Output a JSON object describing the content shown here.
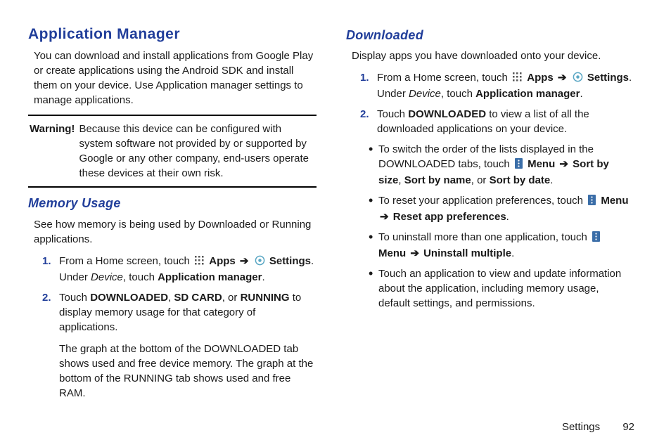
{
  "left": {
    "h1": "Application Manager",
    "intro": "You can download and install applications from Google Play or create applications using the Android SDK and install them on your device. Use Application manager settings to manage applications.",
    "warn_label": "Warning!",
    "warn_text": "Because this device can be configured with system software not provided by or supported by Google or any other company, end-users operate these devices at their own risk.",
    "h2": "Memory Usage",
    "memory_intro": "See how memory is being used by Downloaded or Running applications.",
    "step1_a": "From a Home screen, touch ",
    "apps": "Apps",
    "settings": "Settings",
    "step1_b": ". Under ",
    "device": "Device",
    "step1_c": ", touch ",
    "app_mgr": "Application manager",
    "period": ".",
    "step2_a": "Touch ",
    "downloaded": "DOWNLOADED",
    "sdcard": "SD CARD",
    "running": "RUNNING",
    "step2_b": " to display memory usage for that category of applications.",
    "comma_or": ", or ",
    "comma": ", ",
    "graph": "The graph at the bottom of the DOWNLOADED tab shows used and free device memory. The graph at the bottom of the RUNNING tab shows used and free RAM."
  },
  "right": {
    "h2": "Downloaded",
    "intro": "Display apps you have downloaded onto your device.",
    "step1_a": "From a Home screen, touch ",
    "apps": "Apps",
    "settings": "Settings",
    "step1_b": ". Under ",
    "device": "Device",
    "step1_c": ", touch ",
    "app_mgr": "Application manager",
    "period": ".",
    "step2_a": "Touch ",
    "downloaded": "DOWNLOADED",
    "step2_b": " to view a list of all the downloaded applications on your device.",
    "b1_a": "To switch the order of the lists displayed in the DOWNLOADED tabs, touch ",
    "menu": "Menu",
    "sort_size": "Sort by size",
    "sort_name": "Sort by name",
    "sort_date": "Sort by date",
    "comma": ", ",
    "comma_or": ", or ",
    "b2_a": "To reset your application preferences, touch ",
    "reset": "Reset app preferences",
    "b3_a": "To uninstall more than one application, touch ",
    "uninstall": "Uninstall multiple",
    "b4": "Touch an application to view and update information about the application, including memory usage, default settings, and permissions."
  },
  "arrow": "➔",
  "footer_section": "Settings",
  "footer_page": "92"
}
